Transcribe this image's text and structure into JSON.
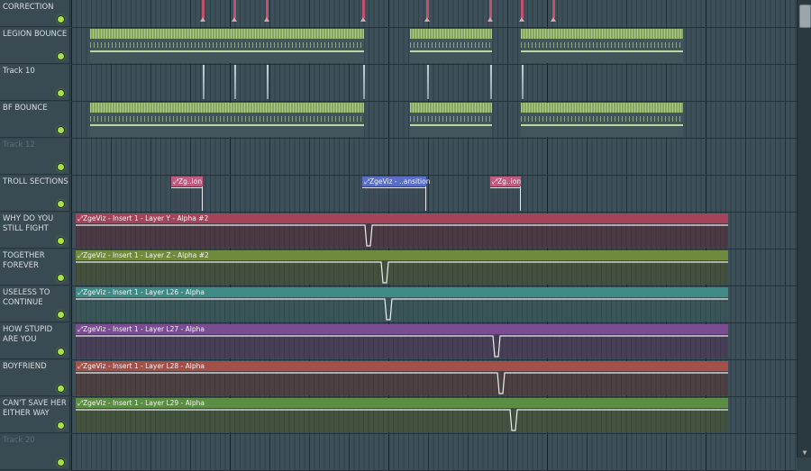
{
  "tracks": [
    {
      "name": "COLOR CORRECTION",
      "dim": false
    },
    {
      "name": "LEGION BOUNCE",
      "dim": false
    },
    {
      "name": "Track 10",
      "dim": false
    },
    {
      "name": "BF BOUNCE",
      "dim": false
    },
    {
      "name": "Track 12",
      "dim": true
    },
    {
      "name": "TROLL SECTIONS",
      "dim": false
    },
    {
      "name": "WHY DO YOU STILL FIGHT",
      "dim": false
    },
    {
      "name": "TOGETHER FOREVER",
      "dim": false
    },
    {
      "name": "USELESS TO CONTINUE",
      "dim": false
    },
    {
      "name": "HOW STUPID ARE YOU",
      "dim": false
    },
    {
      "name": "BOYFRIEND",
      "dim": false
    },
    {
      "name": "CAN'T SAVE HER EITHER WAY",
      "dim": false
    },
    {
      "name": "Track 20",
      "dim": true
    }
  ],
  "troll_clips": [
    {
      "label": "Zg..ion"
    },
    {
      "label": "ZgeViz - ..ansition"
    },
    {
      "label": "Zg..ion"
    }
  ],
  "automation_clips": [
    {
      "label": "ZgeViz - Insert 1 - Layer Y - Alpha #2",
      "color": "#a4445a",
      "body": "#4b3a44"
    },
    {
      "label": "ZgeViz - Insert 1 - Layer Z - Alpha #2",
      "color": "#6f8a3c",
      "body": "#44503e"
    },
    {
      "label": "ZgeViz - Insert 1 - Layer L26 - Alpha",
      "color": "#3e8b86",
      "body": "#3a5558"
    },
    {
      "label": "ZgeViz - Insert 1 - Layer L27 - Alpha",
      "color": "#7a4d92",
      "body": "#473f55"
    },
    {
      "label": "ZgeViz - Insert 1 - Layer L28 - Alpha",
      "color": "#a3504a",
      "body": "#4d4042"
    },
    {
      "label": "ZgeViz - Insert 1 - Layer L29 - Alpha",
      "color": "#5c8d45",
      "body": "#43533f"
    }
  ],
  "icons": {
    "automation": "automation-icon",
    "led": "led-icon",
    "scroll_down": "chevron-down-icon"
  },
  "colors": {
    "pattern_green": "#86a85a",
    "marker_pink": "#c0506c",
    "led_green": "#a6e24e",
    "troll": "#c05a7e",
    "troll_alt": "#5a6ec8"
  }
}
